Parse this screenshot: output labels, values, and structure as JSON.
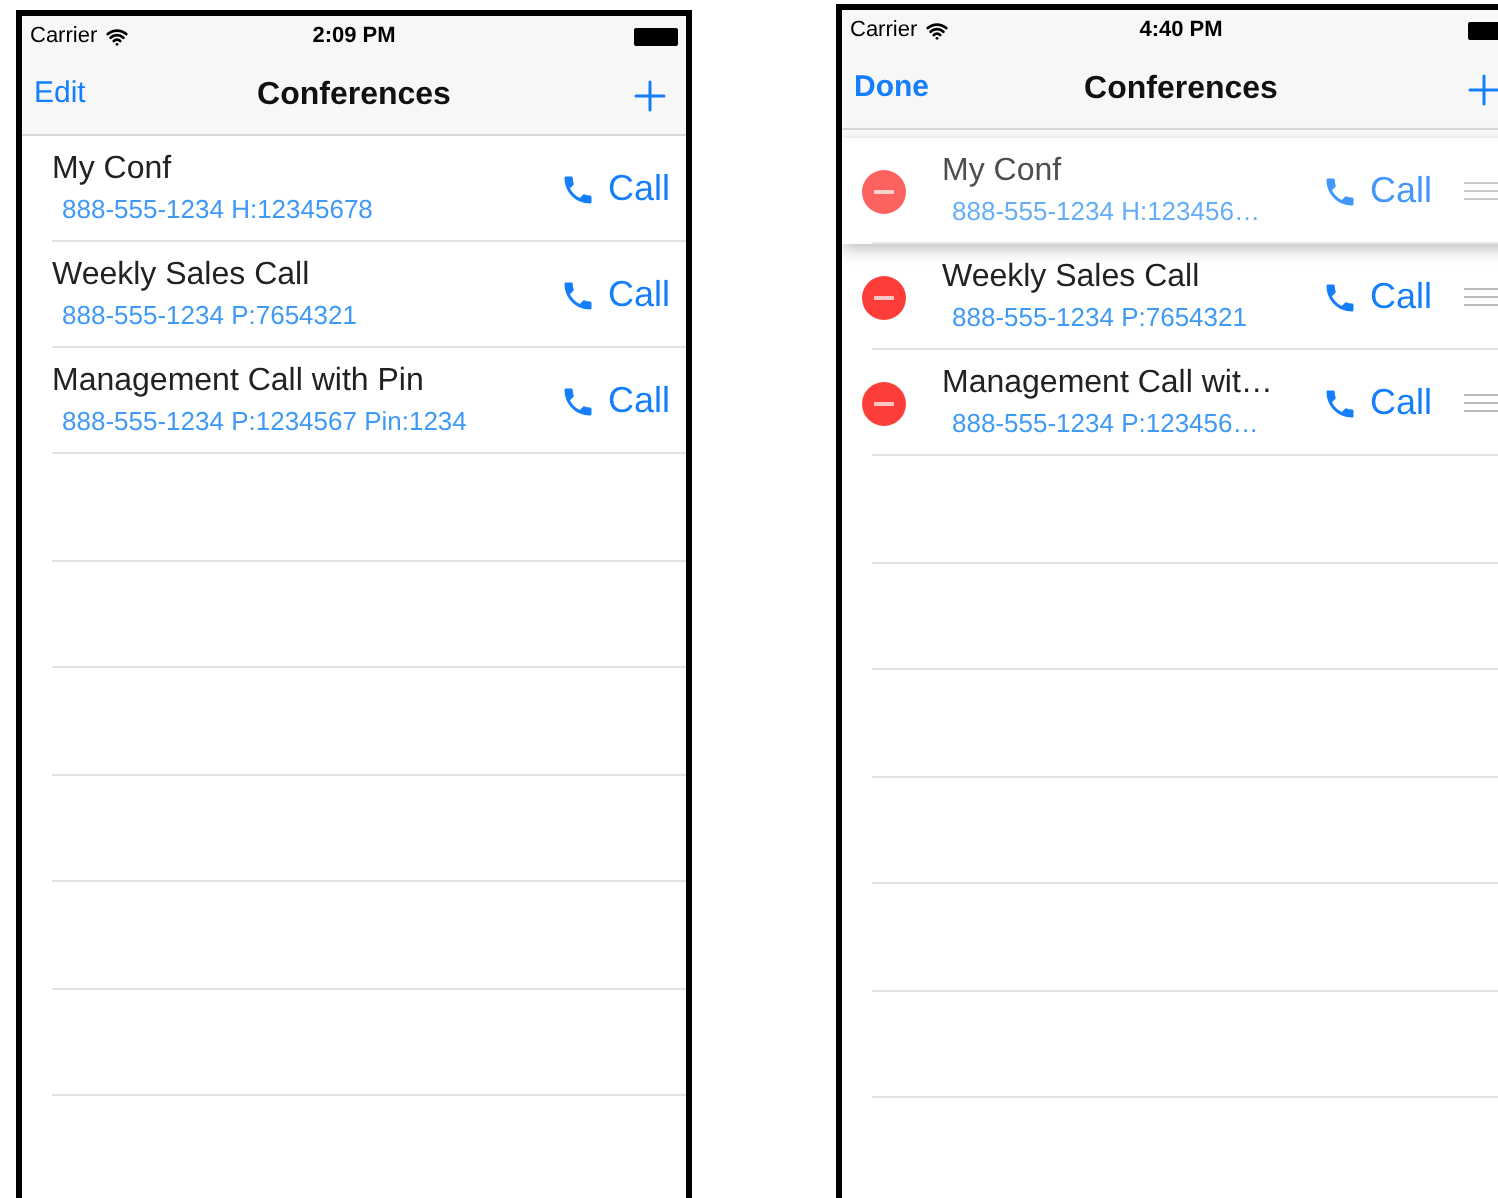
{
  "phones": [
    {
      "editing": false,
      "status": {
        "carrier": "Carrier",
        "time": "2:09 PM"
      },
      "nav": {
        "left_button": "Edit",
        "title": "Conferences"
      },
      "rows": [
        {
          "title": "My Conf",
          "subtitle": "888-555-1234 H:12345678",
          "call_label": "Call",
          "dragging": false
        },
        {
          "title": "Weekly Sales Call",
          "subtitle": "888-555-1234 P:7654321",
          "call_label": "Call",
          "dragging": false
        },
        {
          "title": "Management Call with Pin",
          "subtitle": "888-555-1234 P:1234567 Pin:1234",
          "call_label": "Call",
          "dragging": false
        }
      ]
    },
    {
      "editing": true,
      "status": {
        "carrier": "Carrier",
        "time": "4:40 PM"
      },
      "nav": {
        "left_button": "Done",
        "title": "Conferences"
      },
      "rows": [
        {
          "title": "My Conf",
          "subtitle": "888-555-1234 H:123456…",
          "call_label": "Call",
          "dragging": true
        },
        {
          "title": "Weekly Sales Call",
          "subtitle": "888-555-1234 P:7654321",
          "call_label": "Call",
          "dragging": false
        },
        {
          "title": "Management Call wit…",
          "subtitle": "888-555-1234 P:123456…",
          "call_label": "Call",
          "dragging": false
        }
      ]
    }
  ]
}
